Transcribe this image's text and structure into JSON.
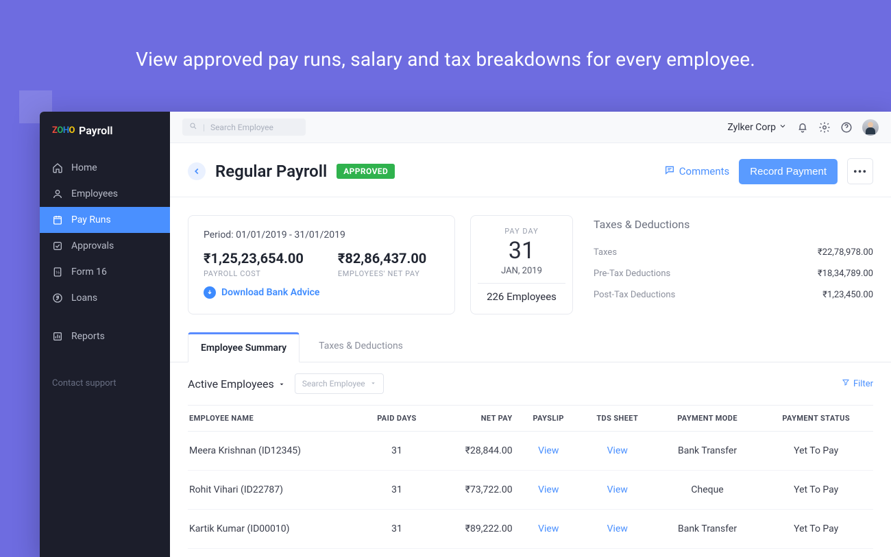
{
  "hero": "View approved pay runs, salary and tax breakdowns for every employee.",
  "app_name": "Payroll",
  "sidebar": {
    "items": [
      {
        "label": "Home",
        "icon": "home-icon"
      },
      {
        "label": "Employees",
        "icon": "person-icon"
      },
      {
        "label": "Pay Runs",
        "icon": "payrun-icon",
        "active": true
      },
      {
        "label": "Approvals",
        "icon": "check-icon"
      },
      {
        "label": "Form 16",
        "icon": "form-icon"
      },
      {
        "label": "Loans",
        "icon": "rupee-icon"
      },
      {
        "label": "Reports",
        "icon": "chart-icon"
      }
    ],
    "contact": "Contact support"
  },
  "topbar": {
    "search_placeholder": "Search Employee",
    "org": "Zylker Corp"
  },
  "header": {
    "title": "Regular Payroll",
    "status": "APPROVED",
    "comments": "Comments",
    "record_payment": "Record Payment"
  },
  "period": {
    "label": "Period:",
    "value": "01/01/2019 - 31/01/2019"
  },
  "payroll_cost": {
    "value": "₹1,25,23,654.00",
    "label": "PAYROLL COST"
  },
  "net_pay": {
    "value": "₹82,86,437.00",
    "label": "EMPLOYEES' NET PAY"
  },
  "download": "Download Bank Advice",
  "payday": {
    "label": "PAY DAY",
    "day": "31",
    "month": "JAN, 2019",
    "count": "226 Employees"
  },
  "taxes": {
    "title": "Taxes & Deductions",
    "rows": [
      {
        "k": "Taxes",
        "v": "₹22,78,978.00"
      },
      {
        "k": "Pre-Tax Deductions",
        "v": "₹18,34,789.00"
      },
      {
        "k": "Post-Tax Deductions",
        "v": "₹1,23,450.00"
      }
    ]
  },
  "tabs": [
    {
      "label": "Employee Summary",
      "active": true
    },
    {
      "label": "Taxes & Deductions"
    }
  ],
  "toolbar": {
    "dropdown": "Active Employees",
    "search_placeholder": "Search Employee",
    "filter": "Filter"
  },
  "table": {
    "columns": [
      "EMPLOYEE NAME",
      "PAID DAYS",
      "NET PAY",
      "PAYSLIP",
      "TDS SHEET",
      "PAYMENT MODE",
      "PAYMENT STATUS"
    ],
    "rows": [
      {
        "name": "Meera Krishnan (ID12345)",
        "paid": "31",
        "net": "₹28,844.00",
        "payslip": "View",
        "tds": "View",
        "mode": "Bank Transfer",
        "status": "Yet To Pay"
      },
      {
        "name": "Rohit Vihari (ID22787)",
        "paid": "31",
        "net": "₹73,722.00",
        "payslip": "View",
        "tds": "View",
        "mode": "Cheque",
        "status": "Yet To Pay"
      },
      {
        "name": "Kartik Kumar (ID00010)",
        "paid": "31",
        "net": "₹89,222.00",
        "payslip": "View",
        "tds": "View",
        "mode": "Bank Transfer",
        "status": "Yet To Pay"
      }
    ]
  }
}
